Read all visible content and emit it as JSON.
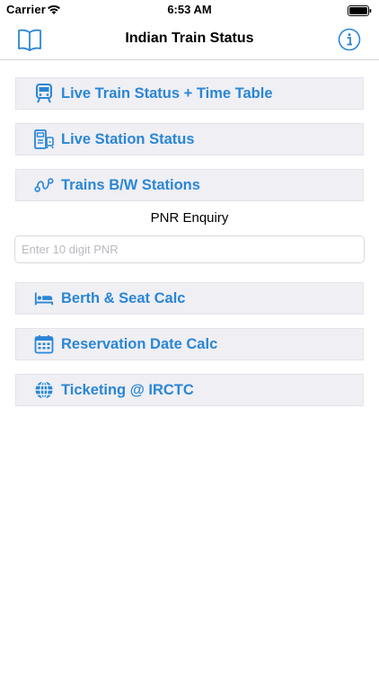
{
  "status_bar": {
    "carrier": "Carrier",
    "time": "6:53 AM",
    "icons": [
      "wifi-icon",
      "battery-icon"
    ]
  },
  "nav": {
    "title": "Indian Train Status",
    "left_icon": "book-icon",
    "right_icon": "info-icon"
  },
  "colors": {
    "accent": "#2a86d6",
    "button_bg": "#efeff4",
    "placeholder": "#b9b9bf"
  },
  "menu": [
    {
      "label": "Live Train Status + Time Table",
      "icon": "train-icon"
    },
    {
      "label": "Live Station Status",
      "icon": "station-icon"
    },
    {
      "label": "Trains B/W Stations",
      "icon": "route-icon"
    }
  ],
  "pnr": {
    "title": "PNR Enquiry",
    "placeholder": "Enter 10 digit PNR",
    "value": ""
  },
  "tools": [
    {
      "label": "Berth & Seat Calc",
      "icon": "bed-icon"
    },
    {
      "label": "Reservation Date Calc",
      "icon": "calendar-icon"
    },
    {
      "label": "Ticketing @ IRCTC",
      "icon": "globe-icon"
    }
  ]
}
